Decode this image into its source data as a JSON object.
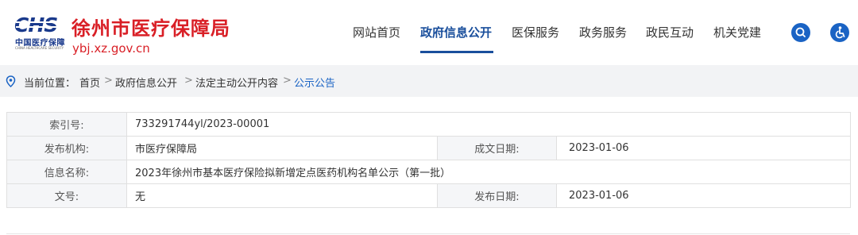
{
  "header": {
    "logo_mark_text": "CHS",
    "logo_cn": "中国医疗保障",
    "logo_en": "CHINA HEALTHCARE SECURITY",
    "title": "徐州市医疗保障局",
    "domain": "ybj.xz.gov.cn"
  },
  "nav": {
    "items": [
      {
        "label": "网站首页"
      },
      {
        "label": "政府信息公开",
        "active": true
      },
      {
        "label": "医保服务"
      },
      {
        "label": "政务服务"
      },
      {
        "label": "政民互动"
      },
      {
        "label": "机关党建"
      }
    ],
    "search_icon": "search-icon",
    "accessibility_icon": "accessibility-icon"
  },
  "breadcrumb": {
    "label": "当前位置：",
    "items": [
      "首页",
      "政府信息公开",
      "法定主动公开内容",
      "公示公告"
    ],
    "separator": ">"
  },
  "info": {
    "index_label": "索引号:",
    "index_value": "733291744yl/2023-00001",
    "org_label": "发布机构:",
    "org_value": "市医疗保障局",
    "created_label": "成文日期:",
    "created_value": "2023-01-06",
    "name_label": "信息名称:",
    "name_value": "2023年徐州市基本医疗保险拟新增定点医药机构名单公示（第一批）",
    "docno_label": "文号:",
    "docno_value": "无",
    "published_label": "发布日期:",
    "published_value": "2023-01-06"
  },
  "colors": {
    "brand_red": "#d91f26",
    "brand_blue": "#1a4f9c",
    "accent_blue": "#1a63c4"
  }
}
